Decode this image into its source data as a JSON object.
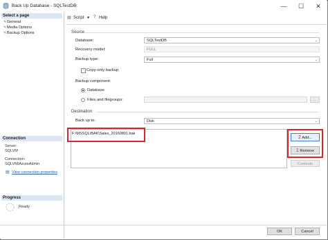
{
  "window": {
    "title": "Back Up Database - SQLTestDB",
    "minimize": "—",
    "maximize": "☐",
    "close": "✕"
  },
  "sidebar": {
    "select_page_heading": "Select a page",
    "pages": [
      {
        "label": "General"
      },
      {
        "label": "Media Options"
      },
      {
        "label": "Backup Options"
      }
    ],
    "connection_heading": "Connection",
    "server_label": "Server:",
    "server_value": "SQLVM",
    "connection_label": "Connection:",
    "connection_value": "SQLVM\\AzureAdmin",
    "view_connection_properties": "View connection properties",
    "progress_heading": "Progress",
    "progress_status": "Ready"
  },
  "toolbar": {
    "script_label": "Script",
    "help_label": "Help"
  },
  "source": {
    "group_label": "Source",
    "database_label": "Database:",
    "database_value": "SQLTestDB",
    "recovery_model_label": "Recovery model:",
    "recovery_model_value": "FULL",
    "backup_type_label": "Backup type:",
    "backup_type_value": "Full",
    "copy_only_label": "Copy-only backup",
    "backup_component_label": "Backup component:",
    "component_database": "Database",
    "component_files": "Files and filegroups:",
    "browse_label": "..."
  },
  "destination": {
    "group_label": "Destination",
    "back_up_to_label": "Back up to:",
    "back_up_to_value": "Disk",
    "path": "F:\\MSSQL\\BAK\\Sales_20160801.bak",
    "add_label": "Add...",
    "remove_label": "Remove",
    "contents_label": "Contents",
    "add_number": "2",
    "remove_number": "1"
  },
  "footer": {
    "ok_label": "OK",
    "cancel_label": "Cancel"
  },
  "colors": {
    "highlight_red": "#d9232d",
    "link_blue": "#2b5ea5",
    "section_header_bg": "#dde7f3"
  }
}
